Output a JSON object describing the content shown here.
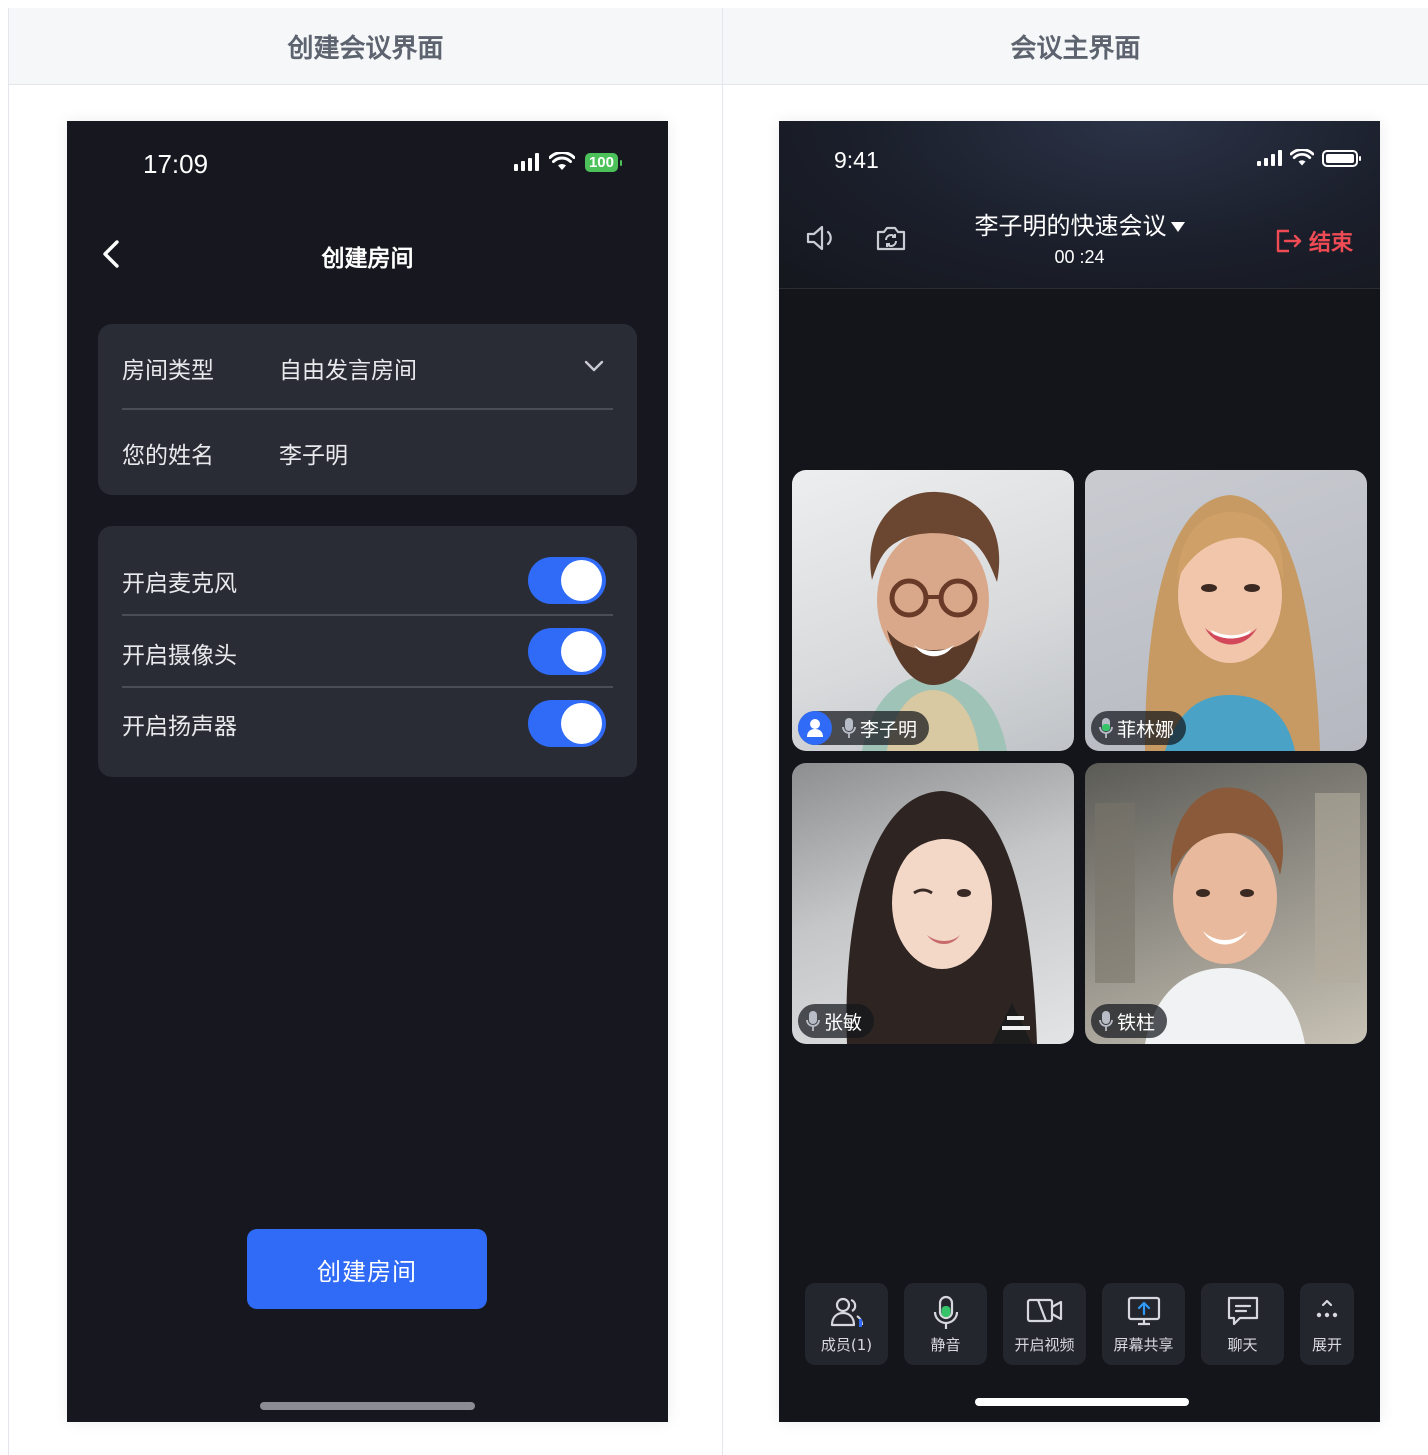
{
  "headers": {
    "left": "创建会议界面",
    "right": "会议主界面"
  },
  "create_screen": {
    "status_time": "17:09",
    "battery": "100",
    "title": "创建房间",
    "room_type_label": "房间类型",
    "room_type_value": "自由发言房间",
    "name_label": "您的姓名",
    "name_value": "李子明",
    "toggles": [
      {
        "label": "开启麦克风",
        "on": true
      },
      {
        "label": "开启摄像头",
        "on": true
      },
      {
        "label": "开启扬声器",
        "on": true
      }
    ],
    "create_button": "创建房间",
    "accent": "#2f6bf6"
  },
  "meeting_screen": {
    "status_time": "9:41",
    "title": "李子明的快速会议",
    "timer": "00 :24",
    "end_button": "结束",
    "end_color": "#ef4b55",
    "participants": [
      {
        "name": "李子明",
        "host": true
      },
      {
        "name": "菲林娜",
        "speaking": true
      },
      {
        "name": "张敏"
      },
      {
        "name": "铁柱"
      }
    ],
    "toolbar": {
      "members": "成员(1)",
      "mute": "静音",
      "video": "开启视频",
      "share": "屏幕共享",
      "chat": "聊天",
      "more": "展开"
    }
  }
}
